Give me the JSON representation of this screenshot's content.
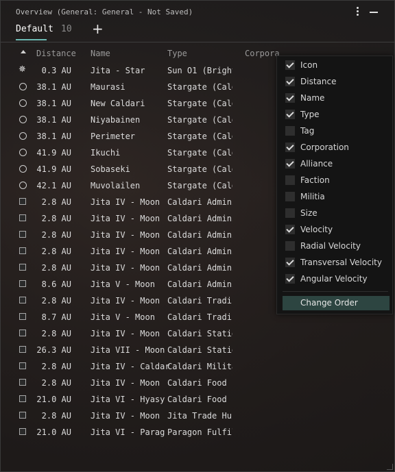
{
  "window": {
    "title": "Overview (General: General - Not Saved)"
  },
  "tabs": [
    {
      "label": "Default",
      "active": true
    },
    {
      "label": "10",
      "active": false
    }
  ],
  "add_tab_label": "+",
  "columns": {
    "distance": "Distance",
    "name": "Name",
    "type": "Type",
    "corporation": "Corpora"
  },
  "rows": [
    {
      "icon": "sun-icon",
      "distance": "0.3 AU",
      "name": "Jita - Star",
      "type": "Sun O1 (Bright"
    },
    {
      "icon": "stargate-icon",
      "distance": "38.1 AU",
      "name": "Maurasi",
      "type": "Stargate (Calda"
    },
    {
      "icon": "stargate-icon",
      "distance": "38.1 AU",
      "name": "New Caldari",
      "type": "Stargate (Calda"
    },
    {
      "icon": "stargate-icon",
      "distance": "38.1 AU",
      "name": "Niyabainen",
      "type": "Stargate (Calda"
    },
    {
      "icon": "stargate-icon",
      "distance": "38.1 AU",
      "name": "Perimeter",
      "type": "Stargate (Calda"
    },
    {
      "icon": "stargate-icon",
      "distance": "41.9 AU",
      "name": "Ikuchi",
      "type": "Stargate (Calda"
    },
    {
      "icon": "stargate-icon",
      "distance": "41.9 AU",
      "name": "Sobaseki",
      "type": "Stargate (Calda"
    },
    {
      "icon": "stargate-icon",
      "distance": "42.1 AU",
      "name": "Muvolailen",
      "type": "Stargate (Calda"
    },
    {
      "icon": "station-icon",
      "distance": "2.8 AU",
      "name": "Jita IV - Moon",
      "type": "Caldari Adminis"
    },
    {
      "icon": "station-icon",
      "distance": "2.8 AU",
      "name": "Jita IV - Moon",
      "type": "Caldari Adminis"
    },
    {
      "icon": "station-icon",
      "distance": "2.8 AU",
      "name": "Jita IV - Moon",
      "type": "Caldari Adminis"
    },
    {
      "icon": "station-icon",
      "distance": "2.8 AU",
      "name": "Jita IV - Moon",
      "type": "Caldari Adminis"
    },
    {
      "icon": "station-icon",
      "distance": "2.8 AU",
      "name": "Jita IV - Moon",
      "type": "Caldari Adminis"
    },
    {
      "icon": "station-icon",
      "distance": "8.6 AU",
      "name": "Jita V - Moon",
      "type": "Caldari Adminis"
    },
    {
      "icon": "station-icon",
      "distance": "2.8 AU",
      "name": "Jita IV - Moon",
      "type": "Caldari Trading"
    },
    {
      "icon": "station-icon",
      "distance": "8.7 AU",
      "name": "Jita V - Moon",
      "type": "Caldari Trading"
    },
    {
      "icon": "station-icon",
      "distance": "2.8 AU",
      "name": "Jita IV - Moon",
      "type": "Caldari Station"
    },
    {
      "icon": "station-icon",
      "distance": "26.3 AU",
      "name": "Jita VII - Moon",
      "type": "Caldari Station"
    },
    {
      "icon": "station-icon",
      "distance": "2.8 AU",
      "name": "Jita IV - Caldar",
      "type": "Caldari Military"
    },
    {
      "icon": "station-icon",
      "distance": "2.8 AU",
      "name": "Jita IV - Moon",
      "type": "Caldari Food Pr"
    },
    {
      "icon": "station-icon",
      "distance": "21.0 AU",
      "name": "Jita VI - Hyasy",
      "type": "Caldari Food Pr"
    },
    {
      "icon": "station-icon",
      "distance": "2.8 AU",
      "name": "Jita IV - Moon",
      "type": "Jita Trade Hub"
    },
    {
      "icon": "station-icon",
      "distance": "21.0 AU",
      "name": "Jita VI - Parag",
      "type": "Paragon Fulfilm"
    }
  ],
  "column_menu": {
    "items": [
      {
        "label": "Icon",
        "checked": true
      },
      {
        "label": "Distance",
        "checked": true
      },
      {
        "label": "Name",
        "checked": true
      },
      {
        "label": "Type",
        "checked": true
      },
      {
        "label": "Tag",
        "checked": false
      },
      {
        "label": "Corporation",
        "checked": true
      },
      {
        "label": "Alliance",
        "checked": true
      },
      {
        "label": "Faction",
        "checked": false
      },
      {
        "label": "Militia",
        "checked": false
      },
      {
        "label": "Size",
        "checked": false
      },
      {
        "label": "Velocity",
        "checked": true
      },
      {
        "label": "Radial Velocity",
        "checked": false
      },
      {
        "label": "Transversal Velocity",
        "checked": true
      },
      {
        "label": "Angular Velocity",
        "checked": true
      }
    ],
    "change_order_label": "Change Order"
  },
  "colors": {
    "accent": "#6dbbb4",
    "button_bg": "#2d4541"
  }
}
